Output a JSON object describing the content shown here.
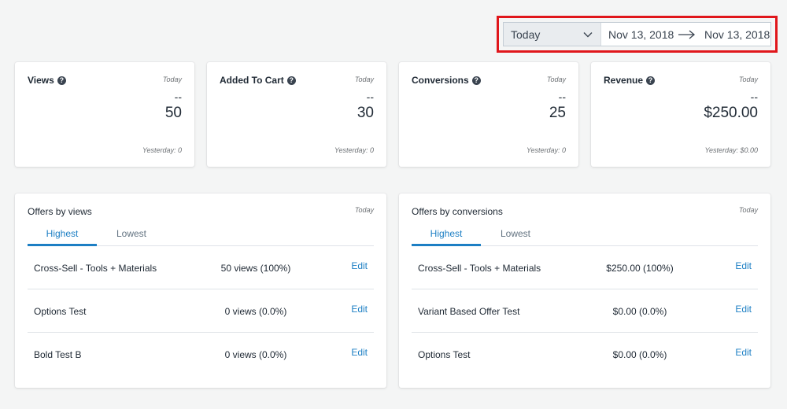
{
  "date_range": {
    "preset": "Today",
    "from": "Nov 13, 2018",
    "to": "Nov 13, 2018",
    "highlight_color": "#e0161b"
  },
  "metrics": [
    {
      "title": "Views",
      "period": "Today",
      "previous": "--",
      "value": "50",
      "yesterday": "Yesterday: 0"
    },
    {
      "title": "Added To Cart",
      "period": "Today",
      "previous": "--",
      "value": "30",
      "yesterday": "Yesterday: 0"
    },
    {
      "title": "Conversions",
      "period": "Today",
      "previous": "--",
      "value": "25",
      "yesterday": "Yesterday: 0"
    },
    {
      "title": "Revenue",
      "period": "Today",
      "previous": "--",
      "value": "$250.00",
      "yesterday": "Yesterday: $0.00"
    }
  ],
  "offers_by_views": {
    "title": "Offers by views",
    "period": "Today",
    "tabs": [
      "Highest",
      "Lowest"
    ],
    "active_tab": "Highest",
    "rows": [
      {
        "name": "Cross-Sell - Tools + Materials",
        "metric": "50 views (100%)",
        "action": "Edit"
      },
      {
        "name": "Options Test",
        "metric": "0 views (0.0%)",
        "action": "Edit"
      },
      {
        "name": "Bold Test B",
        "metric": "0 views (0.0%)",
        "action": "Edit"
      }
    ]
  },
  "offers_by_conversions": {
    "title": "Offers by conversions",
    "period": "Today",
    "tabs": [
      "Highest",
      "Lowest"
    ],
    "active_tab": "Highest",
    "rows": [
      {
        "name": "Cross-Sell - Tools + Materials",
        "metric": "$250.00 (100%)",
        "action": "Edit"
      },
      {
        "name": "Variant Based Offer Test",
        "metric": "$0.00 (0.0%)",
        "action": "Edit"
      },
      {
        "name": "Options Test",
        "metric": "$0.00 (0.0%)",
        "action": "Edit"
      }
    ]
  },
  "accent_color": "#1d7fc4"
}
